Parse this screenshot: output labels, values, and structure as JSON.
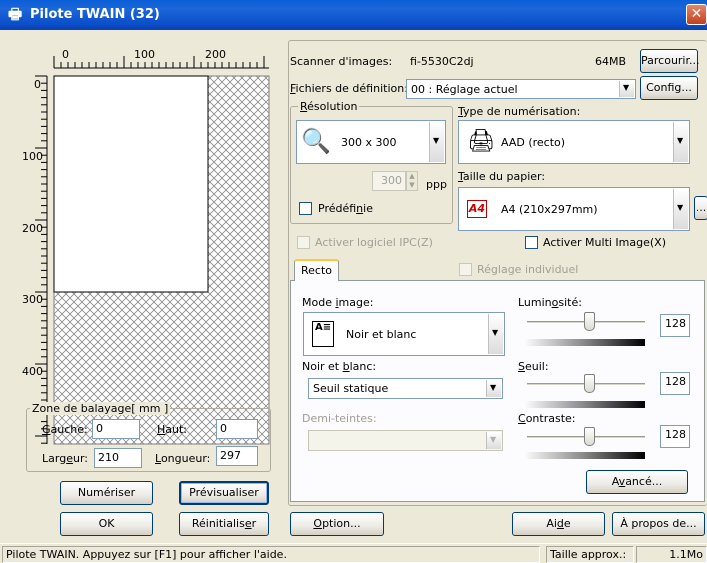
{
  "window": {
    "title": "Pilote TWAIN (32)",
    "close_glyph": "✕"
  },
  "ruler": {
    "top_ticks": [
      "0",
      "100",
      "200"
    ],
    "left_ticks": [
      "0",
      "100",
      "200",
      "300",
      "400"
    ]
  },
  "scan_area": {
    "legend": "Zone de balayage[ mm ]",
    "left_label": "Gauche:",
    "left_value": "0",
    "top_label": "Haut:",
    "top_value": "0",
    "width_label": "Largeur:",
    "width_value": "210",
    "length_label": "Longueur:",
    "length_value": "297"
  },
  "buttons": {
    "scan": "Numériser",
    "preview": "Prévisualiser",
    "ok": "OK",
    "reset": "Réinitialiser",
    "option": "Option...",
    "help": "Aide",
    "about": "À propos de...",
    "browse": "Parcourir...",
    "config": "Config...",
    "advanced": "Avancé...",
    "more": "..."
  },
  "scanner": {
    "label": "Scanner d'images:",
    "model": "fi-5530C2dj",
    "memory": "64MB"
  },
  "definition_file": {
    "label": "Fichiers de définition:",
    "value": "00 : Réglage actuel"
  },
  "resolution": {
    "legend": "Résolution",
    "value": "300 x 300",
    "custom_value": "300",
    "unit": "ppp",
    "predefined_label": "Prédéfinie"
  },
  "scan_type": {
    "label": "Type de numérisation:",
    "value": "AAD (recto)"
  },
  "paper_size": {
    "label": "Taille du papier:",
    "value": "A4 (210x297mm)",
    "icon_text": "A4"
  },
  "options": {
    "ipc_label": "Activer logiciel IPC(Z)",
    "multi_image_label": "Activer Multi Image(X)",
    "individual_label": "Réglage individuel"
  },
  "tab": {
    "label": "Recto"
  },
  "image_mode": {
    "label": "Mode image:",
    "value": "Noir et blanc"
  },
  "bw": {
    "label": "Noir et blanc:",
    "value": "Seuil statique"
  },
  "halftone": {
    "label": "Demi-teintes:",
    "value": ""
  },
  "brightness": {
    "label": "Luminosité:",
    "value": "128"
  },
  "threshold": {
    "label": "Seuil:",
    "value": "128"
  },
  "contrast": {
    "label": "Contraste:",
    "value": "128"
  },
  "status": {
    "message": "Pilote TWAIN. Appuyez sur [F1] pour afficher l'aide.",
    "size_label": "Taille approx.:",
    "size_value": "1.1Mo"
  }
}
